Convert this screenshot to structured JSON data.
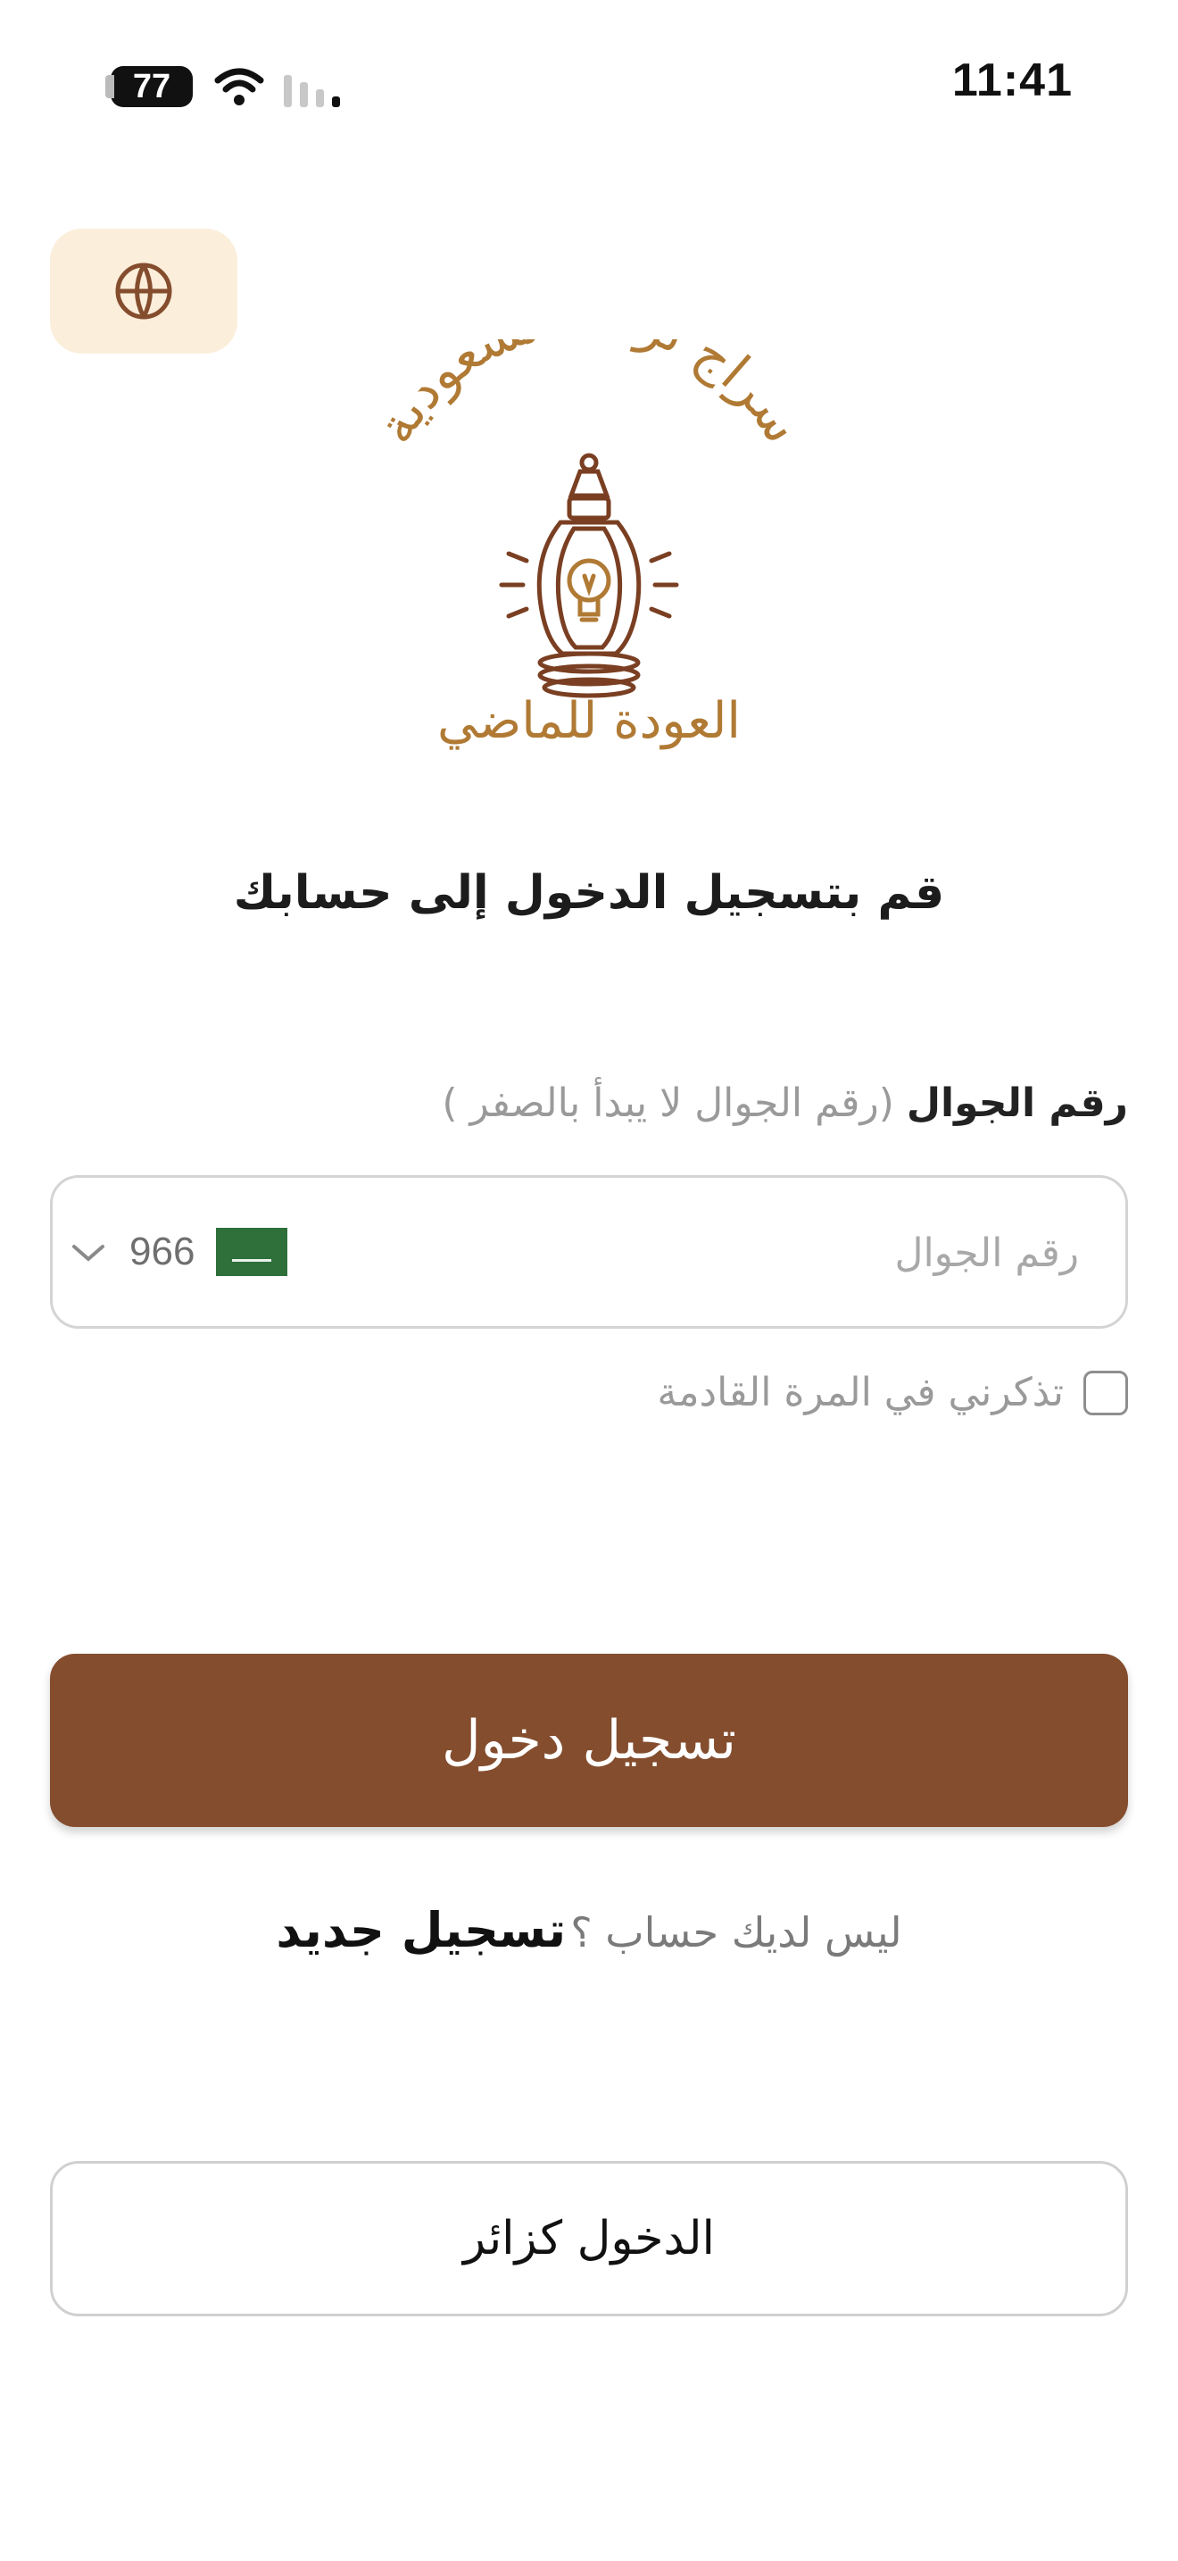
{
  "status_bar": {
    "time": "11:41",
    "battery": "77",
    "icons": [
      "wifi-icon",
      "cellular-signal-icon"
    ]
  },
  "header": {
    "language_icon": "globe-icon"
  },
  "logo": {
    "arc_text": "سراج تراث السعودية",
    "tagline": "العودة للماضي",
    "icon": "lantern-bulb-icon"
  },
  "page": {
    "title": "قم بتسجيل الدخول إلى حسابك"
  },
  "phone": {
    "label": "رقم الجوال",
    "hint": "(رقم الجوال لا يبدأ بالصفر )",
    "placeholder": "رقم الجوال",
    "country_code": "966",
    "flag": "saudi-flag-icon"
  },
  "remember_me": {
    "label": "تذكرني في المرة القادمة",
    "checked": false
  },
  "login_button": {
    "label": "تسجيل دخول"
  },
  "register": {
    "prompt": "ليس لديك حساب ؟",
    "link": "تسجيل جديد"
  },
  "guest_button": {
    "label": "الدخول كزائر"
  },
  "colors": {
    "primary": "#844d2e",
    "accent_bg": "#fbeedb",
    "logo_gold": "#b07a34",
    "logo_brown": "#7a3f22"
  }
}
